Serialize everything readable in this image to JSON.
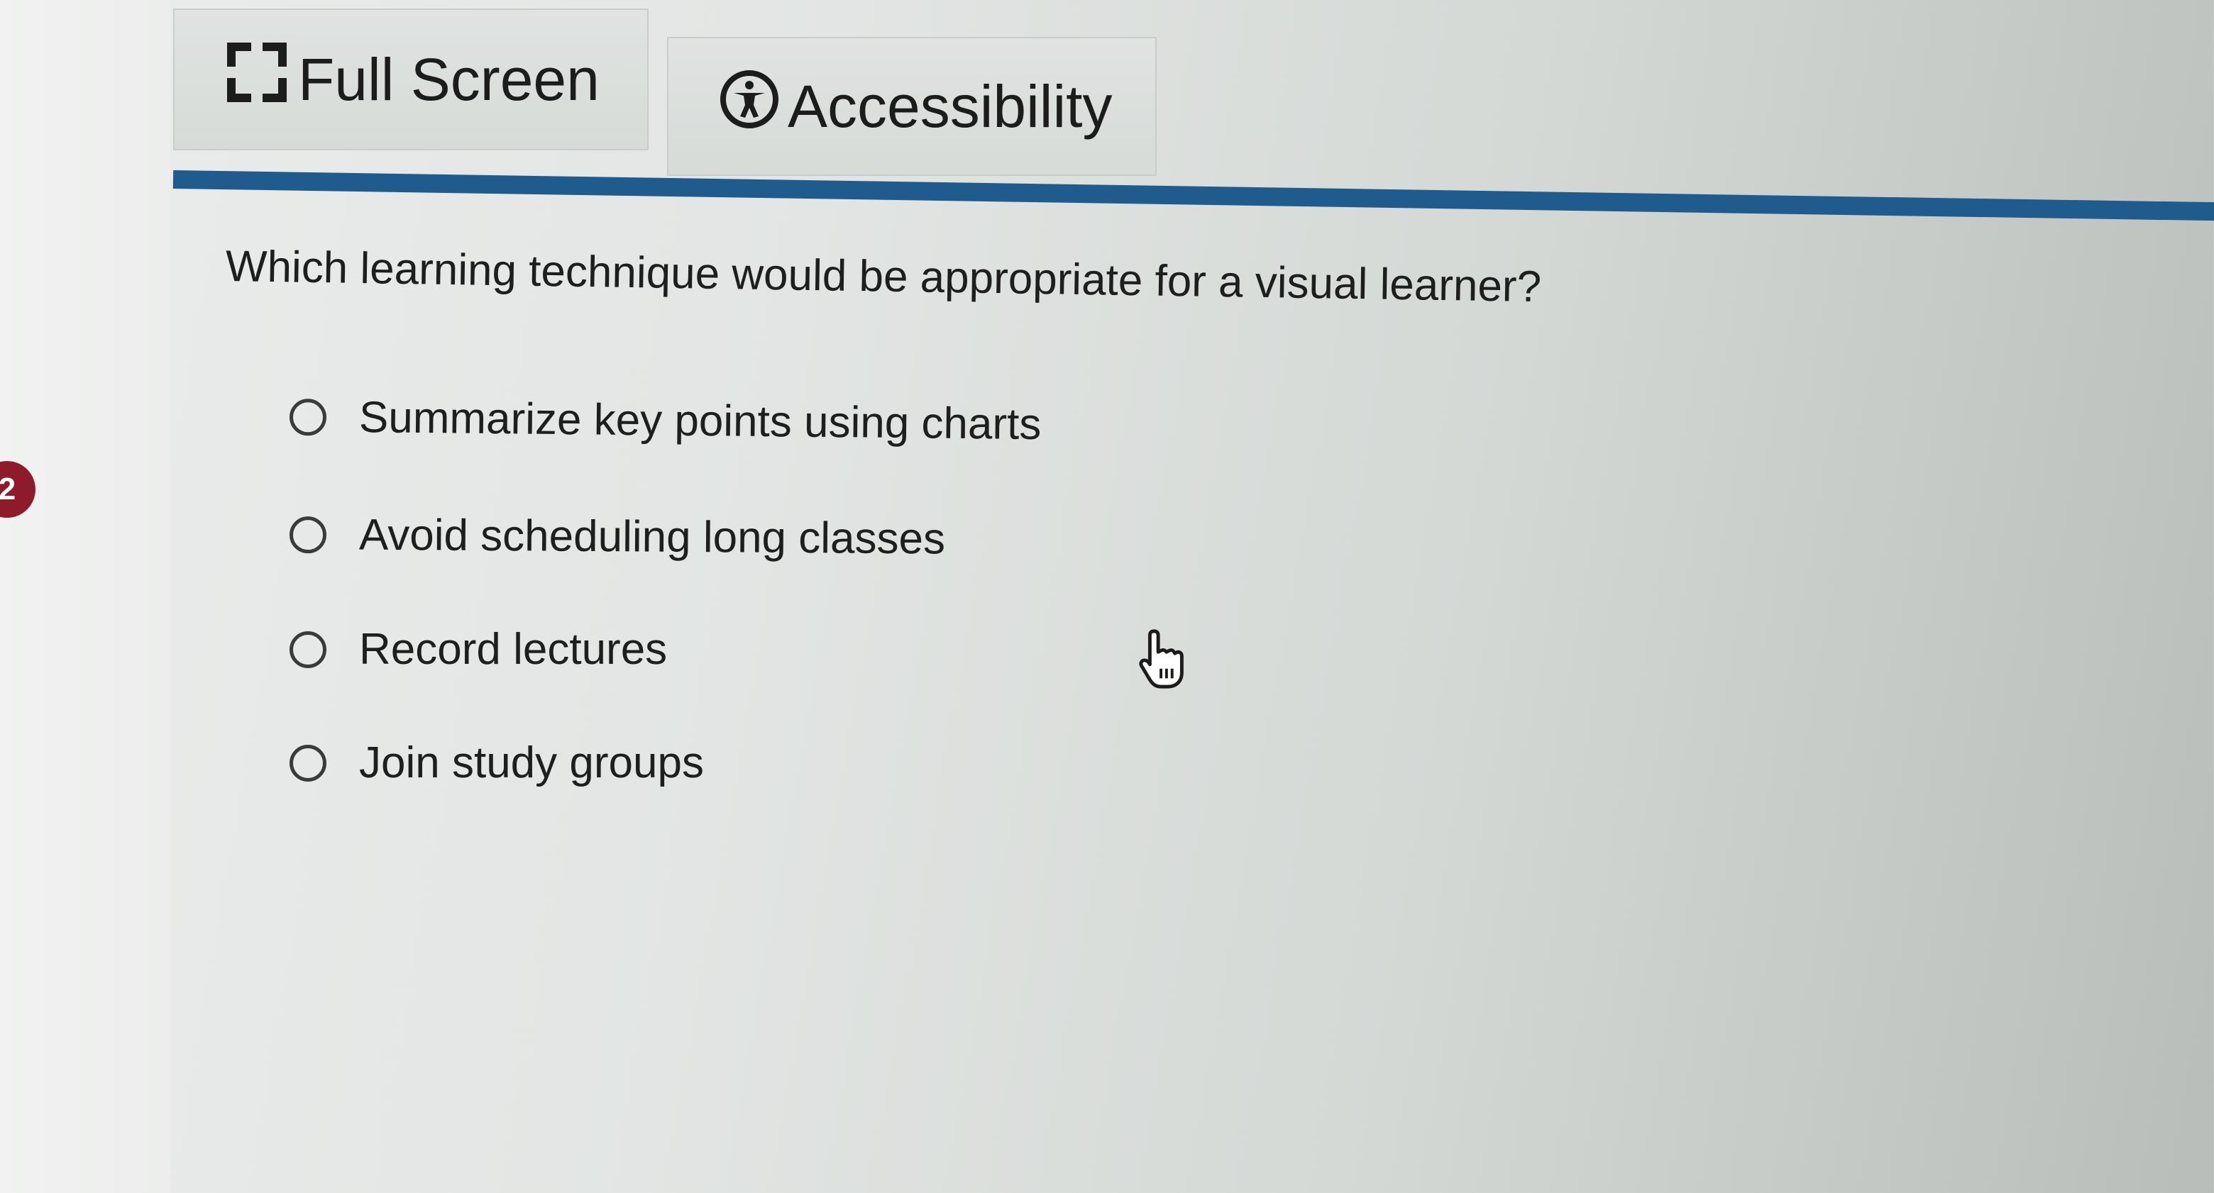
{
  "toolbar": {
    "fullscreen_label": "Full Screen",
    "fullscreen_icon": "fullscreen-icon",
    "accessibility_label": "Accessibility",
    "accessibility_icon": "accessibility-icon"
  },
  "question_number": "2",
  "question": {
    "text": "Which learning technique would be appropriate for a visual learner?",
    "options": [
      {
        "label": "Summarize key points using charts",
        "selected": false
      },
      {
        "label": "Avoid scheduling long classes",
        "selected": false
      },
      {
        "label": "Record lectures",
        "selected": false
      },
      {
        "label": "Join study groups",
        "selected": false
      }
    ]
  },
  "colors": {
    "divider": "#1f5b8d",
    "badge": "#8e1b2a"
  }
}
